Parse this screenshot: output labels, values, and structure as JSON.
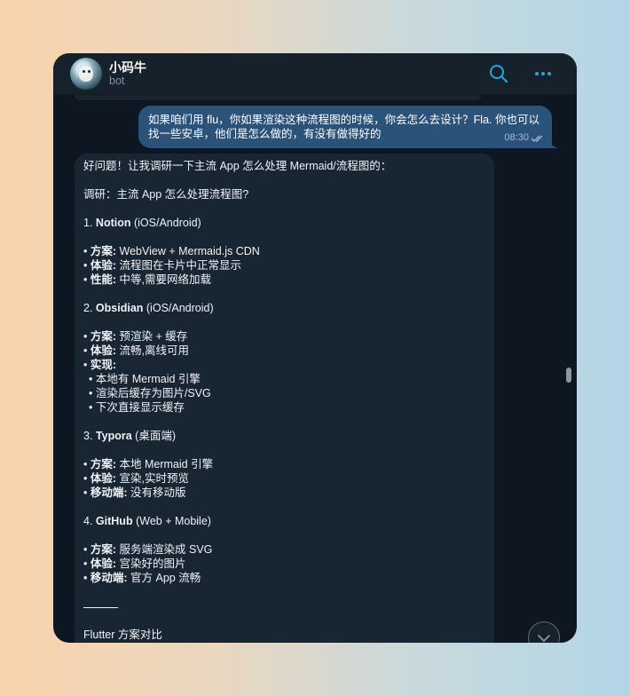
{
  "header": {
    "name": "小码牛",
    "status": "bot"
  },
  "outgoing": {
    "text": "如果咱们用 flu，你如果渲染这种流程图的时候，你会怎么去设计？Fla. 你也可以找一些安卓，他们是怎么做的，有没有做得好的",
    "time": "08:30"
  },
  "reply": {
    "intro": "好问题！让我调研一下主流 App 怎么处理 Mermaid/流程图的：",
    "heading": "调研：主流 App 怎么处理流程图?",
    "sections": [
      {
        "num": "1.",
        "name": "Notion",
        "platform": "(iOS/Android)",
        "items": [
          {
            "label": "方案:",
            "value": "WebView + Mermaid.js CDN"
          },
          {
            "label": "体验:",
            "value": "流程图在卡片中正常显示"
          },
          {
            "label": "性能:",
            "value": "中等,需要网络加载"
          }
        ]
      },
      {
        "num": "2.",
        "name": "Obsidian",
        "platform": "(iOS/Android)",
        "items": [
          {
            "label": "方案:",
            "value": "预渲染 + 缓存"
          },
          {
            "label": "体验:",
            "value": "流畅,离线可用"
          },
          {
            "label": "实现:",
            "value": ""
          }
        ],
        "subitems": [
          "本地有 Mermaid 引擎",
          "渲染后缓存为图片/SVG",
          "下次直接显示缓存"
        ]
      },
      {
        "num": "3.",
        "name": "Typora",
        "platform": "(桌面端)",
        "items": [
          {
            "label": "方案:",
            "value": "本地 Mermaid 引擎"
          },
          {
            "label": "体验:",
            "value": "宣染,实时预览"
          },
          {
            "label": "移动端:",
            "value": "没有移动版"
          }
        ]
      },
      {
        "num": "4.",
        "name": "GitHub",
        "platform": "(Web + Mobile)",
        "items": [
          {
            "label": "方案:",
            "value": "服务端渲染成 SVG"
          },
          {
            "label": "体验:",
            "value": "宫染好的图片"
          },
          {
            "label": "移动端:",
            "value": "官方 App 流畅"
          }
        ]
      }
    ],
    "footer": "Flutter 方案对比"
  },
  "icons": {
    "search": "search-icon",
    "more": "more-icon",
    "read": "double-check-icon",
    "scroll": "chevron-down-icon"
  },
  "colors": {
    "accent": "#2aa0e0",
    "outgoing_bubble": "#2b5278",
    "incoming_bubble": "#182533",
    "background": "#0e1621"
  }
}
